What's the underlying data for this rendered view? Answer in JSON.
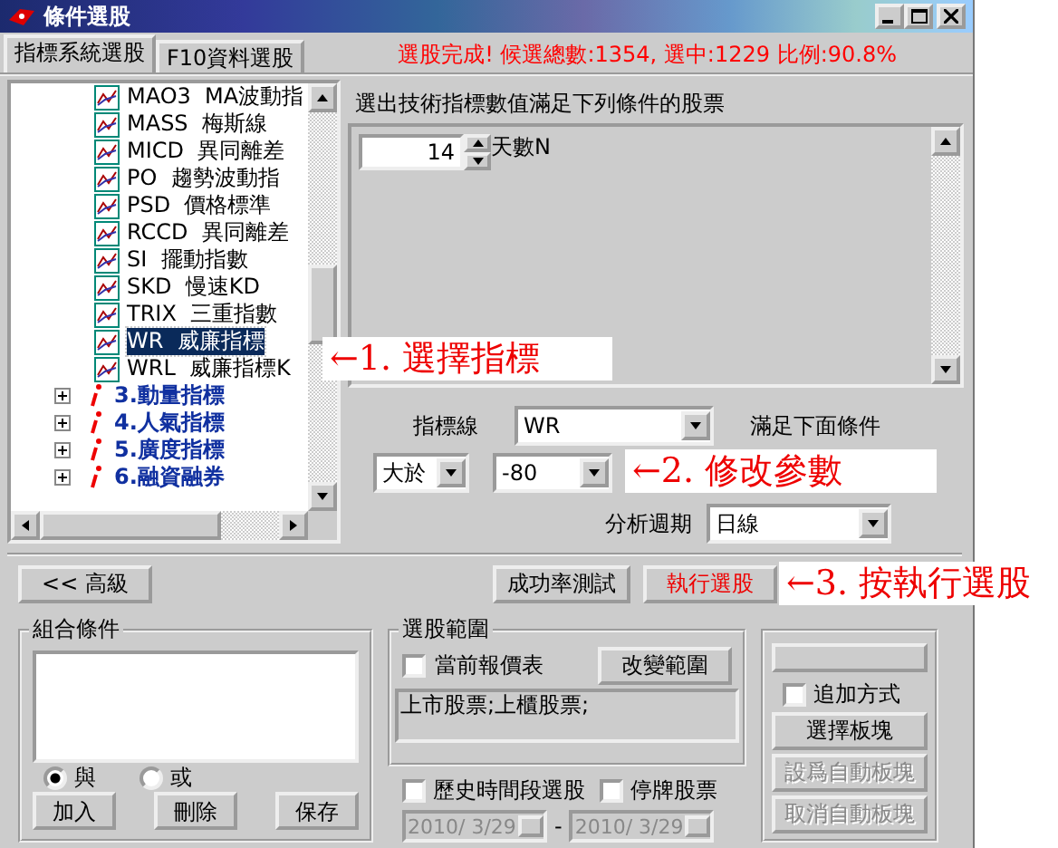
{
  "window": {
    "title": "條件選股"
  },
  "tabs": [
    {
      "label": "指標系統選股",
      "selected": true
    },
    {
      "label": "F10資料選股",
      "selected": false
    }
  ],
  "status": "選股完成! 候選總數:1354, 選中:1229 比例:90.8%",
  "tree": [
    {
      "kind": "indicator",
      "label": "MAO3  MA波動指",
      "selected": false
    },
    {
      "kind": "indicator",
      "label": "MASS  梅斯線",
      "selected": false
    },
    {
      "kind": "indicator",
      "label": "MICD  異同離差",
      "selected": false
    },
    {
      "kind": "indicator",
      "label": "PO  趨勢波動指",
      "selected": false
    },
    {
      "kind": "indicator",
      "label": "PSD  價格標準",
      "selected": false
    },
    {
      "kind": "indicator",
      "label": "RCCD  異同離差",
      "selected": false
    },
    {
      "kind": "indicator",
      "label": "SI  擺動指數",
      "selected": false
    },
    {
      "kind": "indicator",
      "label": "SKD  慢速KD",
      "selected": false
    },
    {
      "kind": "indicator",
      "label": "TRIX  三重指數",
      "selected": false
    },
    {
      "kind": "indicator",
      "label": "WR  威廉指標",
      "selected": true
    },
    {
      "kind": "indicator",
      "label": "WRL  威廉指標K",
      "selected": false
    },
    {
      "kind": "category",
      "label": "3.動量指標",
      "expanded": false
    },
    {
      "kind": "category",
      "label": "4.人氣指標",
      "expanded": false
    },
    {
      "kind": "category",
      "label": "5.廣度指標",
      "expanded": false
    },
    {
      "kind": "category",
      "label": "6.融資融券",
      "expanded": false
    }
  ],
  "criteria_heading": "選出技術指標數值滿足下列條件的股票",
  "parameters": [
    {
      "value": "14",
      "label": "天數N"
    }
  ],
  "indicator_line": {
    "label": "指標線",
    "value": "WR",
    "condition": "滿足下面條件"
  },
  "comparison": {
    "operator": "大於",
    "value": "-80"
  },
  "period": {
    "label": "分析週期",
    "value": "日線"
  },
  "actions": {
    "advanced": "<< 高級",
    "test": "成功率測試",
    "run": "執行選股"
  },
  "combine": {
    "title": "組合條件",
    "options": [
      {
        "label": "與",
        "selected": true
      },
      {
        "label": "或",
        "selected": false
      }
    ],
    "buttons": [
      "加入",
      "刪除",
      "保存"
    ]
  },
  "scope": {
    "title": "選股範圍",
    "current_quotes": {
      "label": "當前報價表",
      "checked": false
    },
    "change_button": "改變範圍",
    "markets": "上市股票;上櫃股票;"
  },
  "history": {
    "label": "歷史時間段選股",
    "checked": false
  },
  "suspended": {
    "label": "停牌股票",
    "checked": false
  },
  "dates": [
    {
      "value": "2010/ 3/29",
      "disabled": true
    },
    {
      "value": "2010/ 3/29",
      "disabled": true
    }
  ],
  "date_separator": "-",
  "block": {
    "append": {
      "label": "追加方式",
      "checked": false
    },
    "buttons": [
      {
        "label": "選擇板塊",
        "disabled": false
      },
      {
        "label": "設爲自動板塊",
        "disabled": true
      },
      {
        "label": "取消自動板塊",
        "disabled": true
      }
    ]
  },
  "annotations": [
    "←1. 選擇指標",
    "←2. 修改參數",
    "←3. 按執行選股"
  ]
}
